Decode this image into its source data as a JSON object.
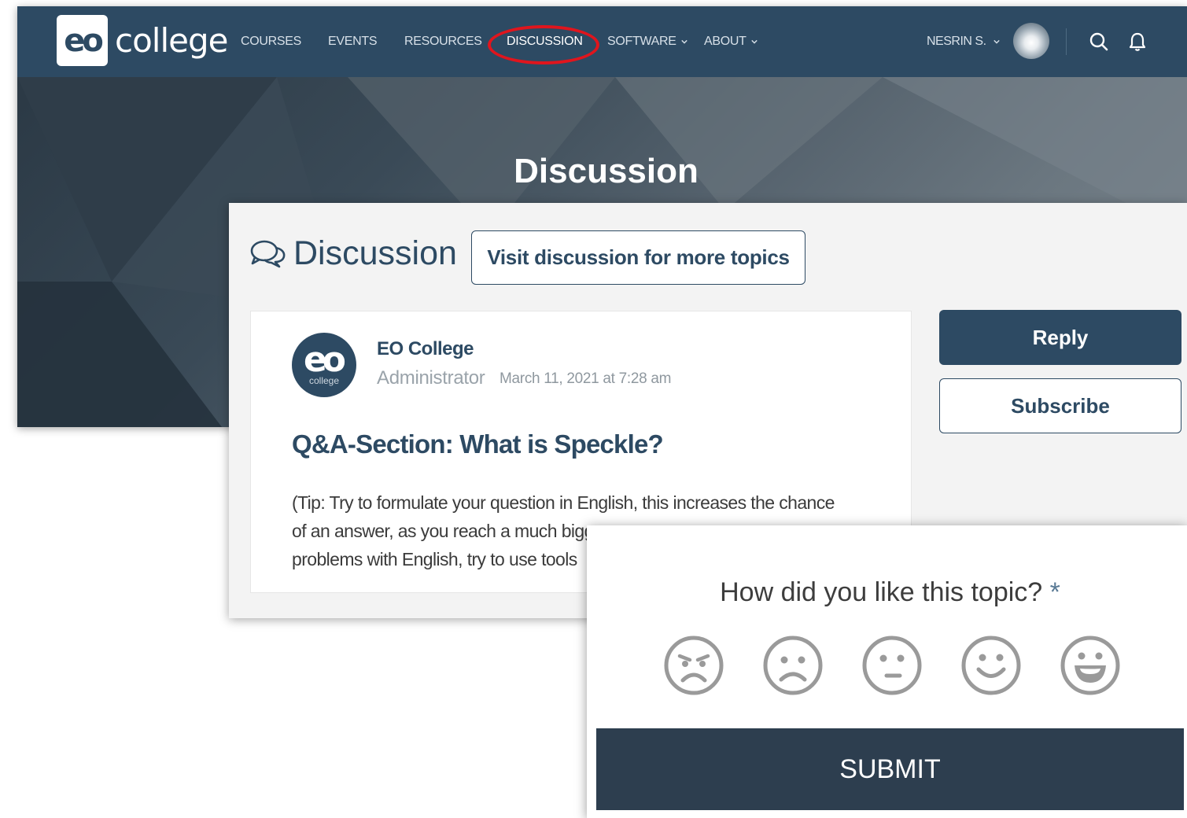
{
  "header": {
    "logo": {
      "mark": "eo",
      "word": "college"
    },
    "nav": [
      {
        "label": "COURSES",
        "dropdown": false
      },
      {
        "label": "EVENTS",
        "dropdown": false
      },
      {
        "label": "RESOURCES",
        "dropdown": false
      },
      {
        "label": "DISCUSSION",
        "dropdown": false,
        "active": true
      },
      {
        "label": "SOFTWARE",
        "dropdown": true
      },
      {
        "label": "ABOUT",
        "dropdown": true
      }
    ],
    "user": {
      "name": "NESRIN S."
    },
    "icons": [
      "search-icon",
      "bell-icon",
      "chevron-down-icon"
    ],
    "colors": {
      "bar": "#2d4a63",
      "highlight": "#e0151d"
    }
  },
  "hero": {
    "title": "Discussion"
  },
  "discussion": {
    "title": "Discussion",
    "icon": "chat-bubbles-icon",
    "visit_label": "Visit discussion for more topics",
    "post": {
      "avatar_mark": "eo",
      "avatar_sub": "college",
      "author": "EO College",
      "role": "Administrator",
      "date": "March 11, 2021 at 7:28 am",
      "title": "Q&A-Section: What is Speckle?",
      "body_lines": [
        "(Tip: Try to formulate your question in English, this increases the chance",
        "of an answer, as you reach a much bigg",
        "problems with English, try to use tools"
      ]
    },
    "reply_label": "Reply",
    "subscribe_label": "Subscribe"
  },
  "rating": {
    "question": "How did you like this topic?",
    "required_mark": "*",
    "faces": [
      "angry-face-icon",
      "sad-face-icon",
      "neutral-face-icon",
      "smile-face-icon",
      "laugh-face-icon"
    ],
    "submit_label": "SUBMIT"
  }
}
